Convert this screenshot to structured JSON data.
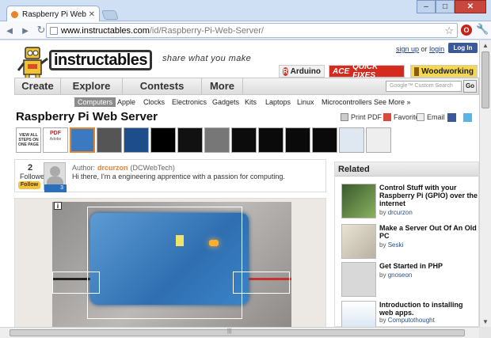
{
  "browser": {
    "tab_title": "Raspberry Pi Web Server",
    "url_domain": "www.instructables.com",
    "url_path": "/id/Raspberry-Pi-Web-Server/",
    "window_buttons": {
      "minimize": "–",
      "maximize": "□",
      "close": "✕"
    }
  },
  "header": {
    "logo_text": "instructables",
    "tagline": "share what you make",
    "sign_up": "sign up",
    "or": "or",
    "login": "login",
    "fb_login": "Log In"
  },
  "partners": [
    "Arduino",
    "ACE",
    "QUICK FIXES",
    "Woodworking"
  ],
  "nav": {
    "items": [
      "Create",
      "Explore",
      "Contests",
      "More"
    ],
    "search_placeholder": "Google™ Custom Search",
    "go": "Go"
  },
  "subnav": [
    "Computers",
    "Apple",
    "Clocks",
    "Electronics",
    "Gadgets",
    "Kits",
    "Laptops",
    "Linux",
    "Microcontrollers",
    "See More »"
  ],
  "page": {
    "title": "Raspberry Pi Web Server",
    "actions": [
      "Print PDF",
      "Favorite",
      "Email"
    ],
    "view_all": "VIEW ALL STEPS ON ONE PAGE",
    "pdf_label": "PDF",
    "pdf_sub": "Adobe"
  },
  "author": {
    "followers_count": "2",
    "followers_label": "Followers",
    "follow_button": "Follow",
    "badge": "3",
    "label": "Author:",
    "name": "drcurzon",
    "handle": "(DCWebTech)",
    "bio": "Hi there, I'm a engineering apprentice with a passion for computing."
  },
  "main_image": {
    "info_button": "i"
  },
  "related": {
    "heading": "Related",
    "items": [
      {
        "title": "Control Stuff with your Raspberry Pi (GPIO) over the internet",
        "by": "by",
        "author": "drcurzon"
      },
      {
        "title": "Make a Server Out Of An Old PC",
        "by": "by",
        "author": "Seski"
      },
      {
        "title": "Get Started in PHP",
        "by": "by",
        "author": "gnoseon"
      },
      {
        "title": "Introduction to installing web apps.",
        "by": "by",
        "author": "Computothought"
      }
    ]
  },
  "colors": {
    "accent_orange": "#e8822a",
    "link_blue": "#1a3d8a",
    "facebook": "#3b5998"
  }
}
